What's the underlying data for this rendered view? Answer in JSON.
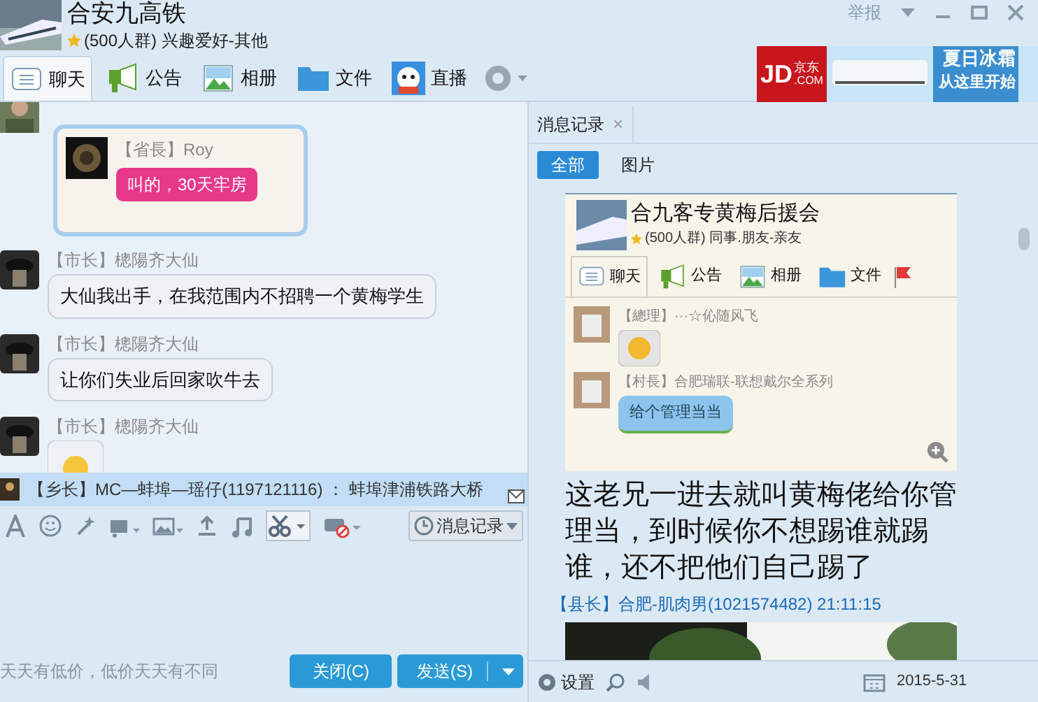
{
  "header": {
    "title": "合安九高铁",
    "subtitle": "(500人群) 兴趣爱好-其他",
    "actions": [
      "举报"
    ]
  },
  "tabs": [
    {
      "label": "聊天",
      "selected": true
    },
    {
      "label": "公告",
      "selected": false
    },
    {
      "label": "相册",
      "selected": false
    },
    {
      "label": "文件",
      "selected": false
    },
    {
      "label": "直播",
      "selected": false
    }
  ],
  "ad": {
    "brand": "JD",
    "brand_sub": "京东",
    "brand_dom": ".COM",
    "line1": "夏日冰霜",
    "line2": "从这里开始"
  },
  "chat": {
    "quoted": {
      "sender": "【省長】Roy",
      "text": "叫的，30天牢房"
    },
    "messages": [
      {
        "sender": "【市长】樬陽齐大仙",
        "text": "大仙我出手，在我范围内不招聘一个黄梅学生",
        "kind": "text"
      },
      {
        "sender": "【市长】樬陽齐大仙",
        "text": "让你们失业后回家吹牛去",
        "kind": "text"
      },
      {
        "sender": "【市长】樬陽齐大仙",
        "kind": "emoji"
      }
    ]
  },
  "notice": "【乡长】MC—蚌埠—瑶仔(1197121116) ： 蚌埠津浦铁路大桥",
  "history_button": "消息记录",
  "input": {
    "hint": "天天有低价，低价天天有不同"
  },
  "buttons": [
    {
      "label": "关闭(C)"
    },
    {
      "label": "发送(S)"
    }
  ],
  "history": {
    "tab": "消息记录",
    "close": "×",
    "filters": [
      {
        "label": "全部",
        "selected": true
      },
      {
        "label": "图片",
        "selected": false
      }
    ],
    "shot": {
      "title": "合九客专黄梅后援会",
      "subtitle": "(500人群) 同事.朋友-亲友",
      "tabs": [
        "聊天",
        "公告",
        "相册",
        "文件"
      ],
      "messages": [
        {
          "sender": "【總理】···☆伈随风飞",
          "kind": "emoji"
        },
        {
          "sender": "【村長】合肥瑞联-联想戴尔全系列",
          "text": "给个管理当当",
          "kind": "text"
        }
      ]
    },
    "text": "这老兄一进去就叫黄梅佬给你管理当，到时候你不想踢谁就踢谁，还不把他们自己踢了",
    "meta": "【县长】合肥-肌肉男(1021574482) 21:11:15",
    "settings": "设置",
    "date": "2015-5-31"
  }
}
